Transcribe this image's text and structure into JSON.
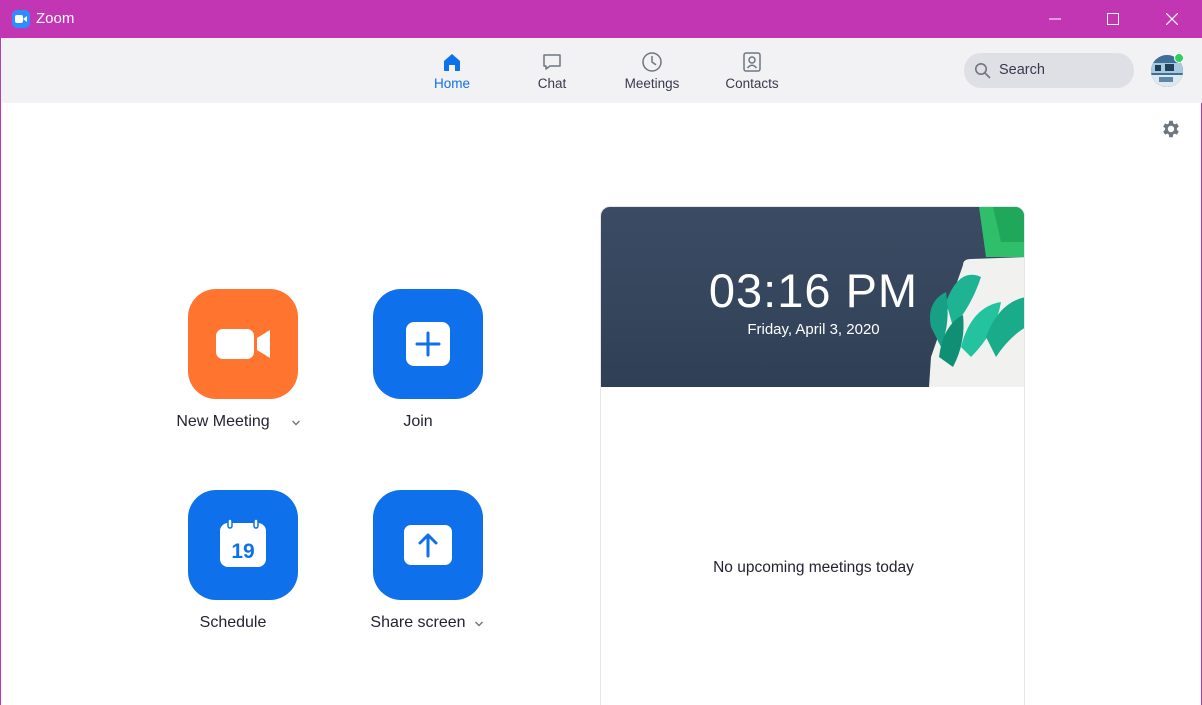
{
  "window": {
    "title": "Zoom"
  },
  "nav": {
    "tabs": [
      {
        "label": "Home",
        "icon": "home-icon",
        "active": true
      },
      {
        "label": "Chat",
        "icon": "chat-icon",
        "active": false
      },
      {
        "label": "Meetings",
        "icon": "clock-icon",
        "active": false
      },
      {
        "label": "Contacts",
        "icon": "contacts-icon",
        "active": false
      }
    ],
    "search_placeholder": "Search"
  },
  "actions": {
    "new_meeting": {
      "label": "New Meeting",
      "icon": "video-camera-icon",
      "color": "#ff742e"
    },
    "join": {
      "label": "Join",
      "icon": "plus-icon",
      "color": "#0e71eb"
    },
    "schedule": {
      "label": "Schedule",
      "icon": "calendar-icon",
      "calendar_day": "19",
      "color": "#0e71eb"
    },
    "share_screen": {
      "label": "Share screen",
      "icon": "share-arrow-icon",
      "color": "#0e71eb"
    }
  },
  "clock": {
    "time": "03:16 PM",
    "date": "Friday, April 3, 2020"
  },
  "meetings": {
    "empty_message": "No upcoming meetings today"
  },
  "colors": {
    "titlebar": "#c236b4",
    "accent": "#0e71eb",
    "presence": "#2ed05c"
  }
}
